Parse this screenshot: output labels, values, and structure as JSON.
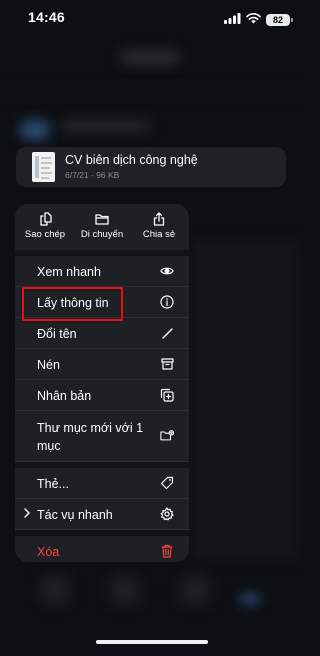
{
  "status_bar": {
    "time": "14:46",
    "battery": "82"
  },
  "file": {
    "name": "CV biên dịch công nghệ",
    "meta": "6/7/21 - 96 KB"
  },
  "quick_actions": [
    {
      "label": "Sao chép",
      "icon": "copy-icon"
    },
    {
      "label": "Di chuyển",
      "icon": "folder-icon"
    },
    {
      "label": "Chia sẻ",
      "icon": "share-icon"
    }
  ],
  "menu": {
    "preview": "Xem nhanh",
    "get_info": "Lấy thông tin",
    "rename": "Đổi tên",
    "compress": "Nén",
    "duplicate": "Nhân bản",
    "new_folder": "Thư mục mới với 1 mục",
    "tags": "Thẻ...",
    "quick_actions": "Tác vụ nhanh",
    "delete": "Xóa"
  },
  "colors": {
    "danger": "#ff453a",
    "highlight": "#e0111a",
    "menu_bg": "#1e2025"
  }
}
